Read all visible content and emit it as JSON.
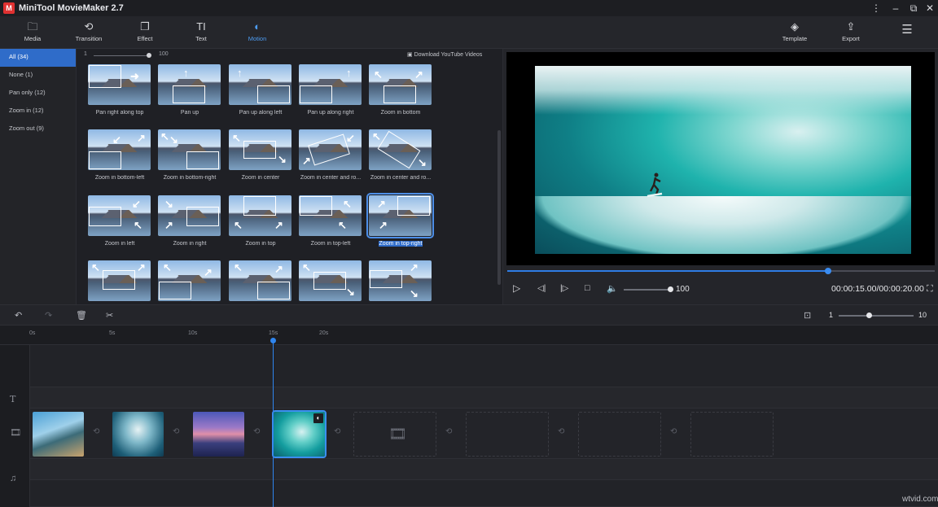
{
  "app": {
    "title": "MiniTool MovieMaker 2.7",
    "logo_text": "M"
  },
  "toolbar": {
    "items": [
      {
        "label": "Media",
        "icon": "folder-icon"
      },
      {
        "label": "Transition",
        "icon": "transition-icon"
      },
      {
        "label": "Effect",
        "icon": "effect-icon"
      },
      {
        "label": "Text",
        "icon": "text-icon"
      },
      {
        "label": "Motion",
        "icon": "motion-icon",
        "active": true
      }
    ],
    "right": [
      {
        "label": "Template",
        "icon": "layers-icon"
      },
      {
        "label": "Export",
        "icon": "export-icon"
      }
    ]
  },
  "categories": [
    {
      "label": "All (34)",
      "active": true
    },
    {
      "label": "None (1)"
    },
    {
      "label": "Pan only (12)"
    },
    {
      "label": "Zoom in (12)"
    },
    {
      "label": "Zoom out (9)"
    }
  ],
  "motion_panel": {
    "slider_min": "1",
    "slider_max": "100",
    "download_link": "Download YouTube Videos",
    "items": [
      "Pan right along top",
      "Pan up",
      "Pan up along left",
      "Pan up along right",
      "Zoom in bottom",
      "Zoom in bottom-left",
      "Zoom in bottom-right",
      "Zoom in center",
      "Zoom in center and ro...",
      "Zoom in center and ro...",
      "Zoom in left",
      "Zoom in right",
      "Zoom in top",
      "Zoom in top-left",
      "Zoom in top-right",
      "",
      "",
      "",
      "",
      ""
    ],
    "selected_index": 14
  },
  "player": {
    "progress": 0.75,
    "volume": "100",
    "timecode": "00:00:15.00/00:00:20.00"
  },
  "timeline": {
    "zoom_min": "1",
    "zoom_max": "10",
    "zoom_level": 0.4,
    "ticks": [
      "0s",
      "5s",
      "10s",
      "15s",
      "20s"
    ]
  },
  "watermark": "wtvid.com",
  "colors": {
    "accent": "#2f7ce4",
    "active_category": "#2f6cc9"
  }
}
